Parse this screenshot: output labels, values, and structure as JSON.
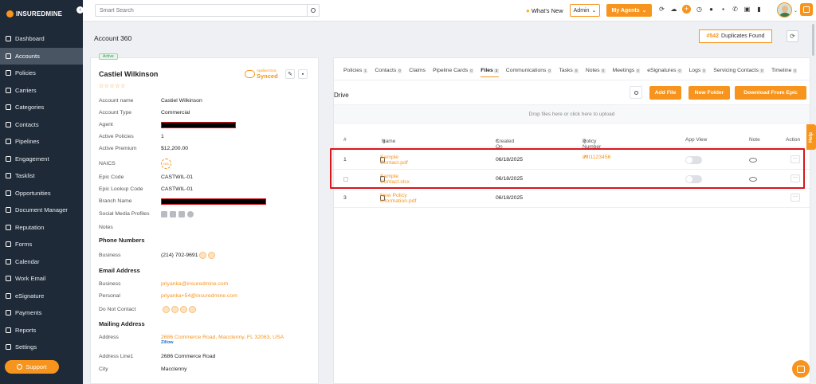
{
  "app": {
    "logo": "INSUREDMINE"
  },
  "sidebar": {
    "items": [
      {
        "label": "Dashboard",
        "icon": "grid-icon"
      },
      {
        "label": "Accounts",
        "icon": "user-icon",
        "active": true
      },
      {
        "label": "Policies",
        "icon": "document-icon"
      },
      {
        "label": "Carriers",
        "icon": "carrier-icon"
      },
      {
        "label": "Categories",
        "icon": "category-icon"
      },
      {
        "label": "Contacts",
        "icon": "contacts-icon"
      },
      {
        "label": "Pipelines",
        "icon": "pipeline-icon"
      },
      {
        "label": "Engagement",
        "icon": "engagement-icon"
      },
      {
        "label": "Tasklist",
        "icon": "tasklist-icon"
      },
      {
        "label": "Opportunities",
        "icon": "chart-icon"
      },
      {
        "label": "Document Manager",
        "icon": "folder-icon"
      },
      {
        "label": "Reputation",
        "icon": "reputation-icon"
      },
      {
        "label": "Forms",
        "icon": "forms-icon"
      },
      {
        "label": "Calendar",
        "icon": "calendar-icon"
      },
      {
        "label": "Work Email",
        "icon": "email-icon"
      },
      {
        "label": "eSignature",
        "icon": "signature-icon"
      },
      {
        "label": "Payments",
        "icon": "payments-icon"
      },
      {
        "label": "Reports",
        "icon": "reports-icon"
      },
      {
        "label": "Settings",
        "icon": "gear-icon"
      }
    ],
    "support_label": "Support"
  },
  "topbar": {
    "search_placeholder": "Smart Search",
    "whats_new": "What's New",
    "admin_label": "Admin",
    "my_agents_label": "My Agents"
  },
  "page": {
    "title": "Account 360",
    "duplicates_count": "#542",
    "duplicates_label": "Duplicates Found"
  },
  "account": {
    "status": "Active",
    "name": "Castiel Wilkinson",
    "rating": "☆☆☆☆☆",
    "sync_caption": "Applied Epic",
    "sync_status": "Synced",
    "fields": {
      "account_name": {
        "label": "Account name",
        "value": "Castiel Wilkinson"
      },
      "account_type": {
        "label": "Account Type",
        "value": "Commercial"
      },
      "agent": {
        "label": "Agent"
      },
      "active_policies": {
        "label": "Active Policies",
        "value": "1"
      },
      "active_premium": {
        "label": "Active Premium",
        "value": "$12,200.00"
      },
      "naics": {
        "label": "NAICS",
        "badge": "N/A"
      },
      "epic_code": {
        "label": "Epic Code",
        "value": "CASTWIL-01"
      },
      "epic_lookup": {
        "label": "Epic Lookup Code",
        "value": "CASTWIL-01"
      },
      "branch_name": {
        "label": "Branch Name"
      },
      "social": {
        "label": "Social Media Profiles"
      },
      "notes": {
        "label": "Notes"
      }
    },
    "phone_header": "Phone Numbers",
    "phone": {
      "label": "Business",
      "value": "(214) 702-9691"
    },
    "email_header": "Email Address",
    "email_business": {
      "label": "Business",
      "value": "priyanka@insuredmine.com"
    },
    "email_personal": {
      "label": "Personal",
      "value": "priyanka+54@insuredmine.com"
    },
    "do_not_contact": {
      "label": "Do Not Contact"
    },
    "mailing_header": "Mailing Address",
    "address": {
      "label": "Address",
      "value": "2686 Commerce Road, Macclenny, FL 32063, USA",
      "zillow": "Zillow"
    },
    "address_line1": {
      "label": "Address Line1",
      "value": "2686 Commerce Road"
    },
    "city": {
      "label": "City",
      "value": "Macclenny"
    }
  },
  "tabs": [
    {
      "label": "Policies",
      "count": "1"
    },
    {
      "label": "Contacts",
      "count": "0"
    },
    {
      "label": "Claims",
      "count": ""
    },
    {
      "label": "Pipeline Cards",
      "count": "0"
    },
    {
      "label": "Files",
      "count": "3",
      "active": true
    },
    {
      "label": "Communications",
      "count": "0"
    },
    {
      "label": "Tasks",
      "count": "0"
    },
    {
      "label": "Notes",
      "count": "0"
    },
    {
      "label": "Meetings",
      "count": "0"
    },
    {
      "label": "eSignatures",
      "count": "0"
    },
    {
      "label": "Logs",
      "count": "0"
    },
    {
      "label": "Servicing Contacts",
      "count": "0"
    },
    {
      "label": "Timeline",
      "count": "0"
    }
  ],
  "drive": {
    "title": "Drive",
    "add_file": "Add File",
    "new_folder": "New Folder",
    "download_epic": "Download From Epic",
    "dropzone": "Drop files here or click here to upload",
    "columns": {
      "num": "#",
      "name": "Name",
      "created": "Created On",
      "policy": "Policy Number",
      "app_view": "App View",
      "note": "Note",
      "action": "Action"
    },
    "rows": [
      {
        "num": "1",
        "name": "Sample Contact.pdf",
        "created": "06/18/2025",
        "policy": "IMI1123456"
      },
      {
        "num": "",
        "name": "Sample Contact.xlsx",
        "created": "06/18/2025",
        "policy": ""
      },
      {
        "num": "3",
        "name": "New Policy Information.pdf",
        "created": "06/18/2025",
        "policy": ""
      }
    ]
  },
  "help_label": "Help"
}
